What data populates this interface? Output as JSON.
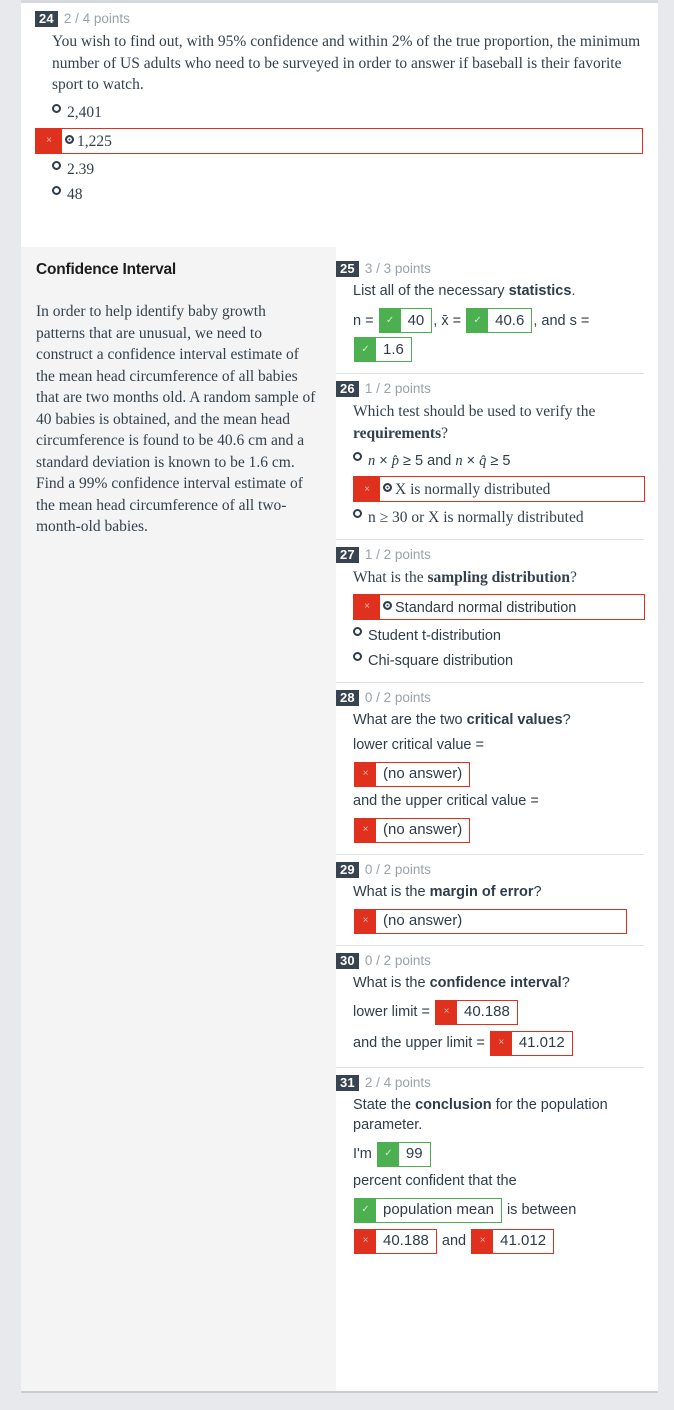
{
  "colors": {
    "page_background": "#e7e9ec",
    "card_background": "#ffffff",
    "left_panel_background": "#f4f4f4",
    "badge_dark": "#37434f",
    "points_gray": "#9aa2ab",
    "correct_green": "#4caf50",
    "wrong_red": "#e0301e",
    "text_ink": "#2e3d49"
  },
  "left_panel": {
    "title": "Confidence Interval",
    "body": "In order to help identify baby growth patterns that are unusual, we need to construct a confidence interval estimate of the mean head circumference of all babies that are two months old.  A random sample of 40 babies is obtained, and the mean head circumference is found to be 40.6 cm and a standard deviation is known to be 1.6 cm. Find a 99% confidence interval estimate of the mean head circumference of all two-month-old babies."
  },
  "q24": {
    "number": "24",
    "points": "2 / 4 points",
    "prompt": "You wish to find out, with 95% confidence and within 2% of the true proportion, the minimum number of US adults who need to be surveyed in order to answer if baseball is their favorite sport to watch.",
    "options": [
      {
        "label": "2,401",
        "selected": false,
        "state": "none"
      },
      {
        "label": "1,225",
        "selected": true,
        "state": "wrong",
        "mark": "×"
      },
      {
        "label": "2.39",
        "selected": false,
        "state": "none"
      },
      {
        "label": "48",
        "selected": false,
        "state": "none"
      }
    ]
  },
  "q25": {
    "number": "25",
    "points": "3 / 3 points",
    "prompt_parts": {
      "pre": "List all of the necessary ",
      "bold": "statistics",
      "post": "."
    },
    "line1": {
      "lead": "n = ",
      "mid": ", x̄ = ",
      "tail": ", and s = "
    },
    "answers": [
      {
        "value": "40",
        "state": "correct",
        "mark": "✓"
      },
      {
        "value": "40.6",
        "state": "correct",
        "mark": "✓"
      },
      {
        "value": "1.6",
        "state": "correct",
        "mark": "✓"
      }
    ]
  },
  "q26": {
    "number": "26",
    "points": "1 / 2 points",
    "prompt_parts": {
      "pre": "Which test should be used to verify the ",
      "bold": "requirements",
      "post": "?"
    },
    "options": [
      {
        "label": "n × p̂ ≥ 5 and n × q̂ ≥ 5",
        "selected": false,
        "state": "none",
        "math": true
      },
      {
        "label": "X is normally distributed",
        "selected": true,
        "state": "wrong",
        "mark": "×"
      },
      {
        "label": "n ≥ 30 or X is normally distributed",
        "selected": false,
        "state": "none",
        "math": true
      }
    ]
  },
  "q27": {
    "number": "27",
    "points": "1 / 2 points",
    "prompt_parts": {
      "pre": "What is the ",
      "bold": "sampling distribution",
      "post": "?"
    },
    "options": [
      {
        "label": "Standard normal distribution",
        "selected": true,
        "state": "wrong",
        "mark": "×"
      },
      {
        "label": "Student t-distribution",
        "selected": false,
        "state": "none"
      },
      {
        "label": "Chi-square distribution",
        "selected": false,
        "state": "none"
      }
    ]
  },
  "q28": {
    "number": "28",
    "points": "0 / 2 points",
    "prompt_parts": {
      "pre": "What are the two ",
      "bold": "critical values",
      "post": "?"
    },
    "label_lower": "lower critical value =",
    "label_upper": "and the upper critical value =",
    "answer_lower": {
      "value": "(no answer)",
      "state": "wrong",
      "mark": "×"
    },
    "answer_upper": {
      "value": "(no answer)",
      "state": "wrong",
      "mark": "×"
    }
  },
  "q29": {
    "number": "29",
    "points": "0 / 2 points",
    "prompt_parts": {
      "pre": "What is the ",
      "bold": "margin of error",
      "post": "?"
    },
    "answer": {
      "value": "(no answer)",
      "state": "wrong",
      "mark": "×"
    }
  },
  "q30": {
    "number": "30",
    "points": "0 / 2 points",
    "prompt_parts": {
      "pre": "What is the ",
      "bold": "confidence interval",
      "post": "?"
    },
    "label_lower": "lower limit = ",
    "label_upper": "and the upper limit = ",
    "answer_lower": {
      "value": "40.188",
      "state": "wrong",
      "mark": "×"
    },
    "answer_upper": {
      "value": "41.012",
      "state": "wrong",
      "mark": "×"
    }
  },
  "q31": {
    "number": "31",
    "points": "2 / 4 points",
    "prompt_parts": {
      "pre": "State the ",
      "bold": "conclusion",
      "post": " for the population parameter."
    },
    "line_a_lead": "I'm ",
    "answer_confidence": {
      "value": "99",
      "state": "correct",
      "mark": "✓"
    },
    "line_b": "percent confident that the",
    "answer_parameter": {
      "value": "population mean",
      "state": "correct",
      "mark": "✓"
    },
    "line_c": " is between",
    "answer_lower": {
      "value": "40.188",
      "state": "wrong",
      "mark": "×"
    },
    "joiner": "and",
    "answer_upper": {
      "value": "41.012",
      "state": "wrong",
      "mark": "×"
    }
  }
}
